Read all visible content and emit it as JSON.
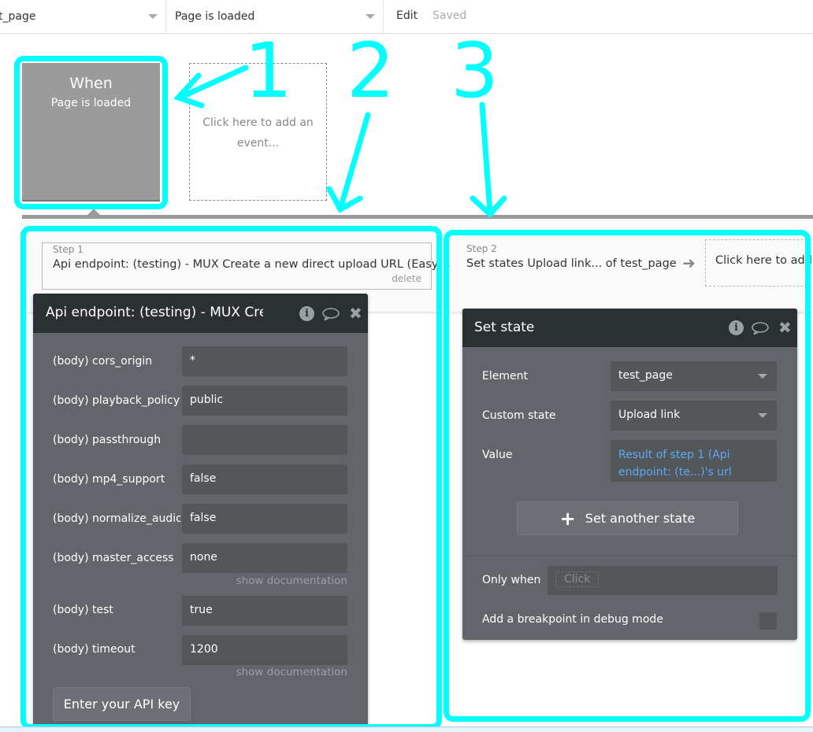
{
  "topbar": {
    "page_select": "t_page",
    "event_select": "Page is loaded",
    "edit_label": "Edit",
    "saved_label": "Saved"
  },
  "event_card": {
    "when_label": "When",
    "event_name": "Page is loaded"
  },
  "add_event": {
    "label": "Click here to add an event..."
  },
  "steps": [
    {
      "label": "Step 1",
      "title": "Api endpoint: (testing) - MUX Create a new direct upload URL (Easy)",
      "delete_label": "delete"
    },
    {
      "label": "Step 2",
      "title": "Set states Upload link... of test_page"
    }
  ],
  "add_action": {
    "label": "Click here to add an action..."
  },
  "api_panel": {
    "title": "Api endpoint: (testing) - MUX Create a new direct upload URL (Easy)",
    "icons": [
      "info-icon",
      "comment-icon",
      "close-icon"
    ],
    "fields": [
      {
        "label": "(body) cors_origin",
        "value": "*"
      },
      {
        "label": "(body) playback_policy",
        "value": "public"
      },
      {
        "label": "(body) passthrough",
        "value": ""
      },
      {
        "label": "(body) mp4_support",
        "value": "false"
      },
      {
        "label": "(body) normalize_audio",
        "value": "false"
      },
      {
        "label": "(body) master_access",
        "value": "none"
      },
      {
        "label": "(body) test",
        "value": "true"
      },
      {
        "label": "(body) timeout",
        "value": "1200"
      }
    ],
    "show_documentation": "show documentation",
    "api_key_button": "Enter your API key"
  },
  "set_state_panel": {
    "title": "Set state",
    "icons": [
      "info-icon",
      "comment-icon",
      "close-icon"
    ],
    "element_label": "Element",
    "element_value": "test_page",
    "custom_state_label": "Custom state",
    "custom_state_value": "Upload link",
    "value_label": "Value",
    "value_expression": "Result of step 1 (Api endpoint: (te...)'s url",
    "set_another_button": "Set another state",
    "only_when_label": "Only when",
    "only_when_placeholder": "Click",
    "breakpoint_label": "Add a breakpoint in debug mode",
    "breakpoint_checked": false
  },
  "annotations": {
    "color": "#00ffff",
    "numbers": [
      "1",
      "2",
      "3"
    ]
  }
}
